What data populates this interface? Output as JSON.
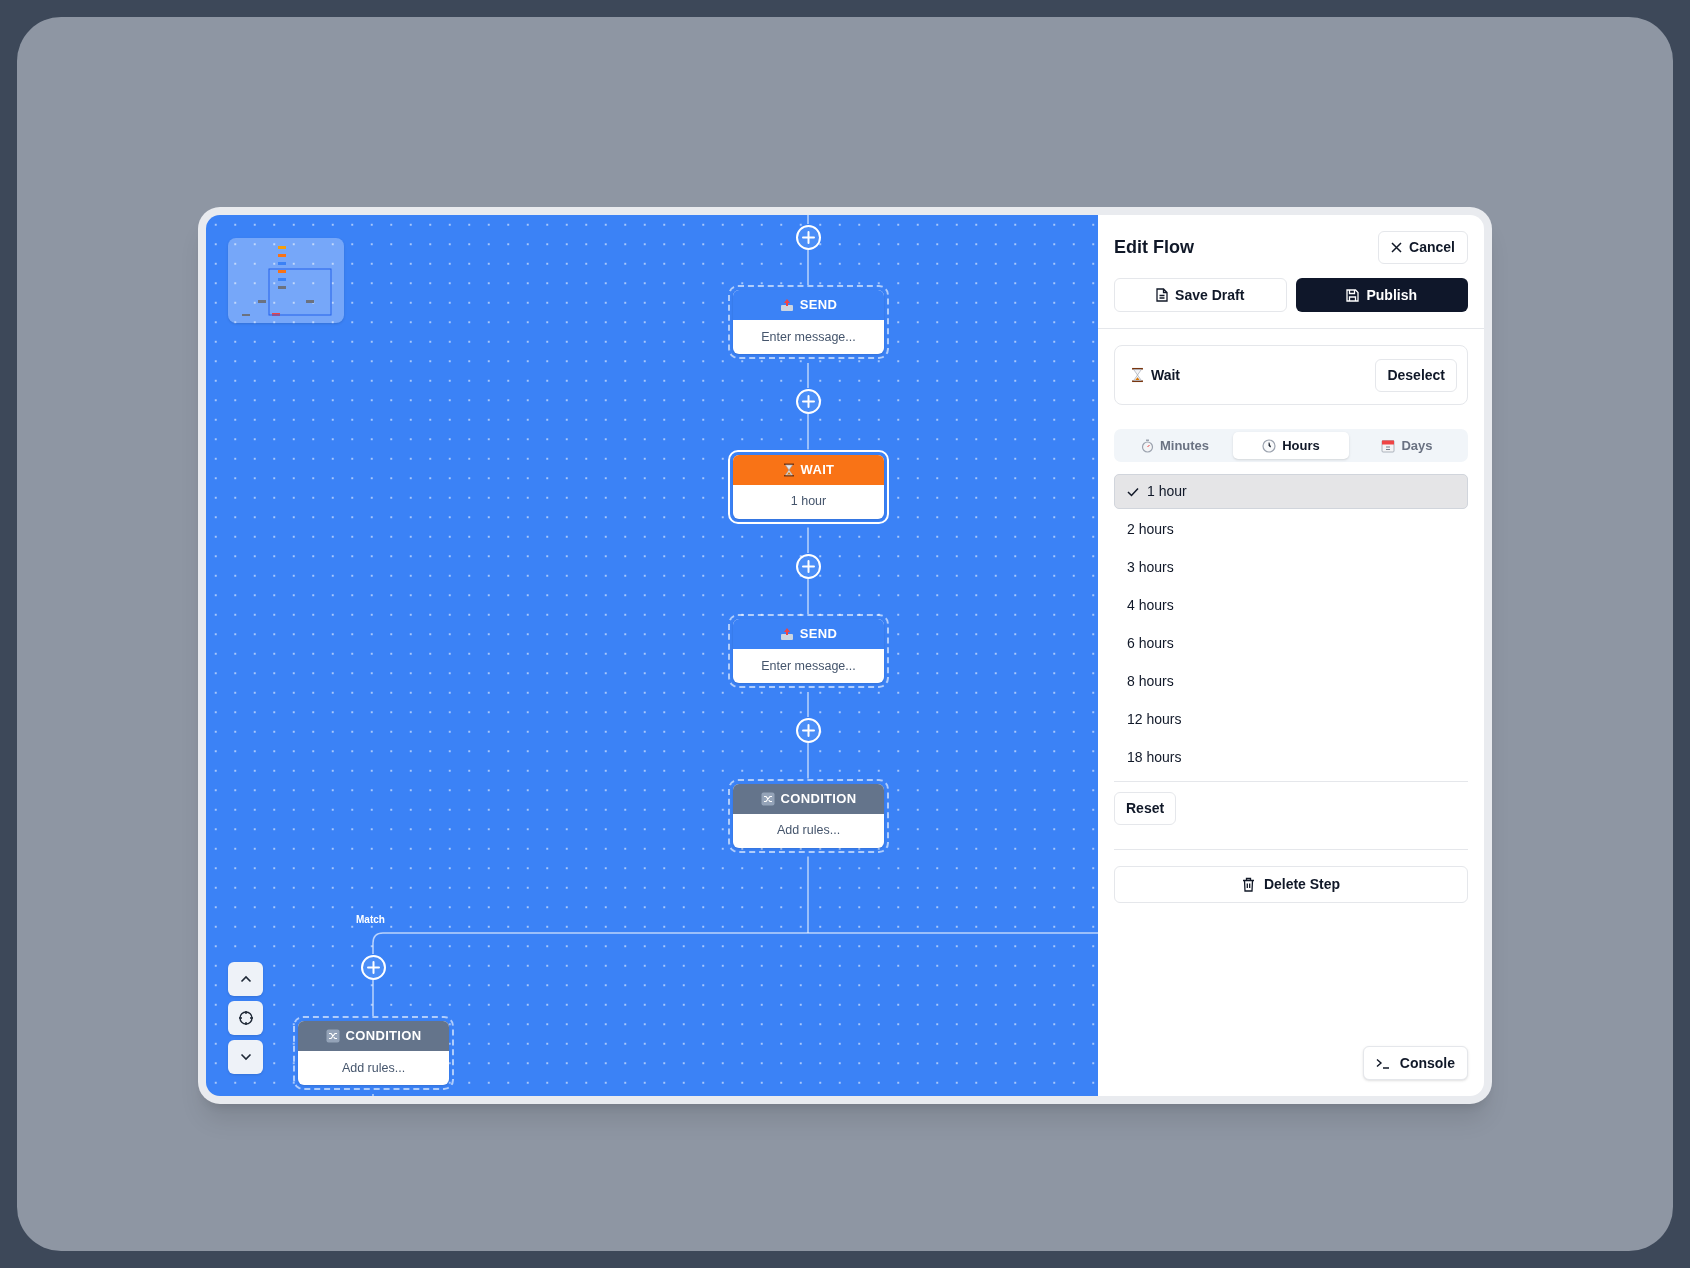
{
  "canvas": {
    "nodes": [
      {
        "kind": "send",
        "title": "SEND",
        "body": "Enter message...",
        "selected": false
      },
      {
        "kind": "wait",
        "title": "WAIT",
        "body": "1 hour",
        "selected": true
      },
      {
        "kind": "send",
        "title": "SEND",
        "body": "Enter message...",
        "selected": false
      },
      {
        "kind": "condition",
        "title": "CONDITION",
        "body": "Add rules...",
        "selected": false
      }
    ],
    "branch": {
      "label": "Match",
      "node": {
        "kind": "condition",
        "title": "CONDITION",
        "body": "Add rules...",
        "selected": false
      }
    }
  },
  "panel": {
    "title": "Edit Flow",
    "cancel": "Cancel",
    "save_draft": "Save Draft",
    "publish": "Publish",
    "step": {
      "kind": "wait",
      "label": "Wait"
    },
    "deselect": "Deselect",
    "unit_tabs": [
      {
        "kind": "minutes",
        "label": "Minutes",
        "selected": false
      },
      {
        "kind": "hours",
        "label": "Hours",
        "selected": true
      },
      {
        "kind": "days",
        "label": "Days",
        "selected": false
      }
    ],
    "options": [
      {
        "label": "1 hour",
        "selected": true
      },
      {
        "label": "2 hours",
        "selected": false
      },
      {
        "label": "3 hours",
        "selected": false
      },
      {
        "label": "4 hours",
        "selected": false
      },
      {
        "label": "6 hours",
        "selected": false
      },
      {
        "label": "8 hours",
        "selected": false
      },
      {
        "label": "12 hours",
        "selected": false
      },
      {
        "label": "18 hours",
        "selected": false
      }
    ],
    "reset": "Reset",
    "delete": "Delete Step",
    "console": "Console"
  }
}
